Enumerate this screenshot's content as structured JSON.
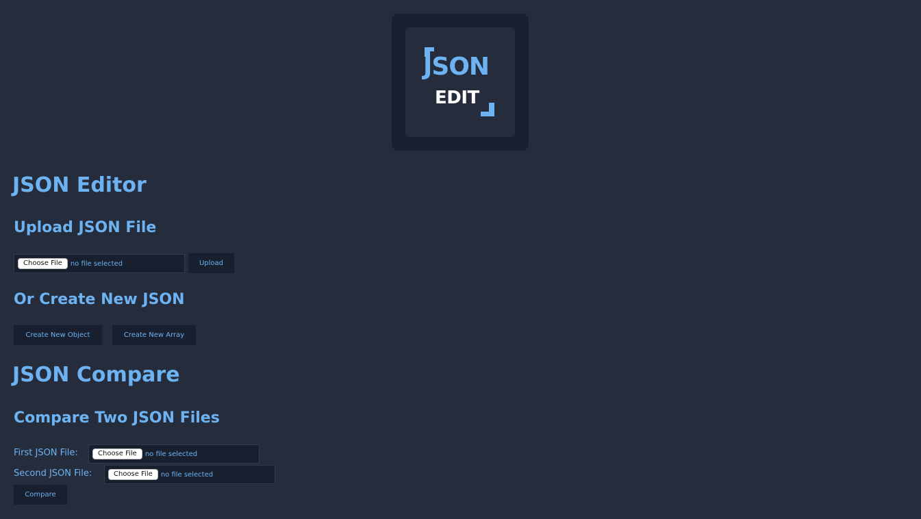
{
  "logo": {
    "line1": "JSON",
    "line2": "EDIT"
  },
  "editor": {
    "title": "JSON Editor",
    "upload_heading": "Upload JSON File",
    "choose_file_label": "Choose File",
    "no_file_text": "no file selected",
    "upload_button": "Upload",
    "create_heading": "Or Create New JSON",
    "create_object_button": "Create New Object",
    "create_array_button": "Create New Array"
  },
  "compare": {
    "title": "JSON Compare",
    "subheading": "Compare Two JSON Files",
    "first_label": "First JSON File:",
    "second_label": "Second JSON File:",
    "choose_file_label": "Choose File",
    "no_file_text": "no file selected",
    "compare_button": "Compare"
  },
  "colors": {
    "background": "#252d3d",
    "panel": "#181f2e",
    "accent": "#6db3f2",
    "white": "#ffffff"
  }
}
